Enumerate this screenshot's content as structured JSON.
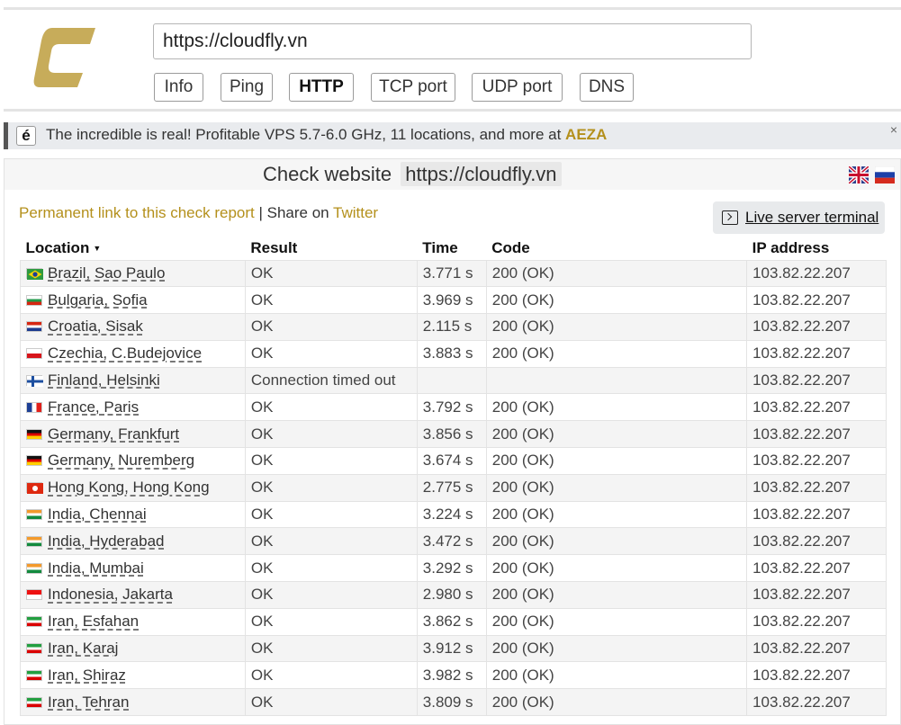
{
  "search": {
    "url": "https://cloudfly.vn"
  },
  "tabs": [
    {
      "label": "Info",
      "active": false
    },
    {
      "label": "Ping",
      "active": false
    },
    {
      "label": "HTTP",
      "active": true
    },
    {
      "label": "TCP port",
      "active": false
    },
    {
      "label": "UDP port",
      "active": false
    },
    {
      "label": "DNS",
      "active": false
    }
  ],
  "banner": {
    "logo": "é",
    "text": "The incredible is real! Profitable VPS 5.7-6.0 GHz, 11 locations, and more at",
    "brand": "AEZA",
    "close": "×"
  },
  "check": {
    "title": "Check website",
    "url": "https://cloudfly.vn",
    "permalink": "Permanent link to this check report",
    "share": "| Share on",
    "twitter": "Twitter",
    "live_terminal": "Live server terminal"
  },
  "table": {
    "headers": [
      "Location",
      "Result",
      "Time",
      "Code",
      "IP address"
    ],
    "rows": [
      {
        "flag": "br",
        "location": "Brazil, Sao Paulo",
        "result": "OK",
        "time": "3.771 s",
        "code": "200 (OK)",
        "ip": "103.82.22.207"
      },
      {
        "flag": "bg",
        "location": "Bulgaria, Sofia",
        "result": "OK",
        "time": "3.969 s",
        "code": "200 (OK)",
        "ip": "103.82.22.207"
      },
      {
        "flag": "hr",
        "location": "Croatia, Sisak",
        "result": "OK",
        "time": "2.115 s",
        "code": "200 (OK)",
        "ip": "103.82.22.207"
      },
      {
        "flag": "cz",
        "location": "Czechia, C.Budejovice",
        "result": "OK",
        "time": "3.883 s",
        "code": "200 (OK)",
        "ip": "103.82.22.207"
      },
      {
        "flag": "fi",
        "location": "Finland, Helsinki",
        "result": "Connection timed out",
        "time": "",
        "code": "",
        "ip": "103.82.22.207",
        "error": true
      },
      {
        "flag": "fr",
        "location": "France, Paris",
        "result": "OK",
        "time": "3.792 s",
        "code": "200 (OK)",
        "ip": "103.82.22.207"
      },
      {
        "flag": "de",
        "location": "Germany, Frankfurt",
        "result": "OK",
        "time": "3.856 s",
        "code": "200 (OK)",
        "ip": "103.82.22.207"
      },
      {
        "flag": "de",
        "location": "Germany, Nuremberg",
        "result": "OK",
        "time": "3.674 s",
        "code": "200 (OK)",
        "ip": "103.82.22.207"
      },
      {
        "flag": "hk",
        "location": "Hong Kong, Hong Kong",
        "result": "OK",
        "time": "2.775 s",
        "code": "200 (OK)",
        "ip": "103.82.22.207"
      },
      {
        "flag": "in",
        "location": "India, Chennai",
        "result": "OK",
        "time": "3.224 s",
        "code": "200 (OK)",
        "ip": "103.82.22.207"
      },
      {
        "flag": "in",
        "location": "India, Hyderabad",
        "result": "OK",
        "time": "3.472 s",
        "code": "200 (OK)",
        "ip": "103.82.22.207"
      },
      {
        "flag": "in",
        "location": "India, Mumbai",
        "result": "OK",
        "time": "3.292 s",
        "code": "200 (OK)",
        "ip": "103.82.22.207"
      },
      {
        "flag": "id",
        "location": "Indonesia, Jakarta",
        "result": "OK",
        "time": "2.980 s",
        "code": "200 (OK)",
        "ip": "103.82.22.207"
      },
      {
        "flag": "ir",
        "location": "Iran, Esfahan",
        "result": "OK",
        "time": "3.862 s",
        "code": "200 (OK)",
        "ip": "103.82.22.207"
      },
      {
        "flag": "ir",
        "location": "Iran, Karaj",
        "result": "OK",
        "time": "3.912 s",
        "code": "200 (OK)",
        "ip": "103.82.22.207"
      },
      {
        "flag": "ir",
        "location": "Iran, Shiraz",
        "result": "OK",
        "time": "3.982 s",
        "code": "200 (OK)",
        "ip": "103.82.22.207"
      },
      {
        "flag": "ir",
        "location": "Iran, Tehran",
        "result": "OK",
        "time": "3.809 s",
        "code": "200 (OK)",
        "ip": "103.82.22.207"
      }
    ]
  },
  "colors": {
    "accent": "#b4901c",
    "error": "#d12f2f"
  }
}
